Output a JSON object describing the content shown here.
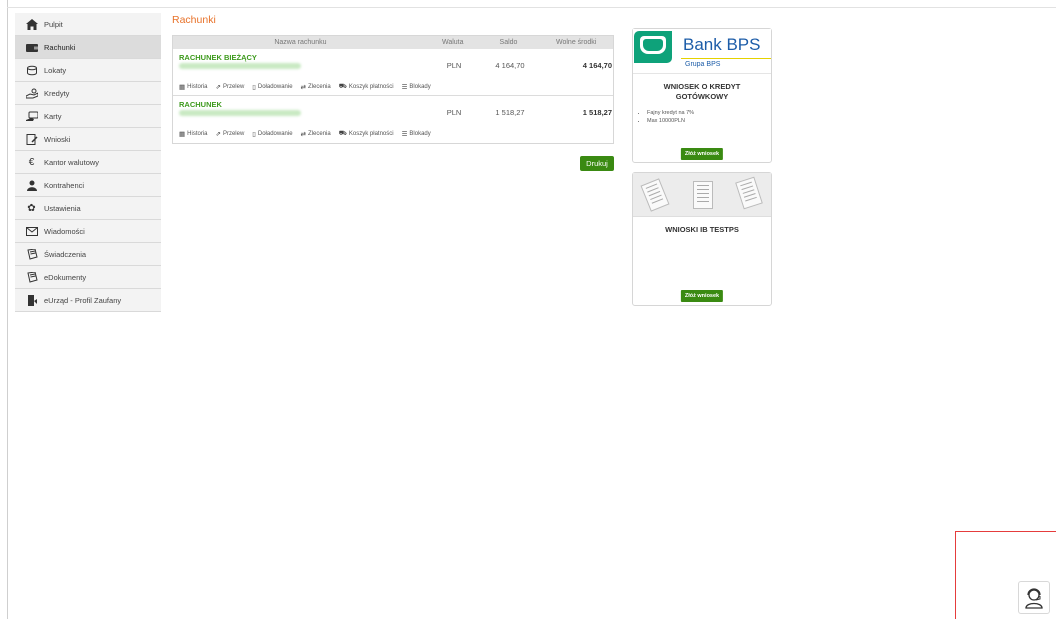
{
  "sidebar": {
    "items": [
      {
        "label": "Pulpit",
        "icon": "home-icon",
        "active": false
      },
      {
        "label": "Rachunki",
        "icon": "wallet-icon",
        "active": true
      },
      {
        "label": "Lokaty",
        "icon": "coins-icon",
        "active": false
      },
      {
        "label": "Kredyty",
        "icon": "hand-money-icon",
        "active": false
      },
      {
        "label": "Karty",
        "icon": "card-hand-icon",
        "active": false
      },
      {
        "label": "Wnioski",
        "icon": "form-icon",
        "active": false
      },
      {
        "label": "Kantor walutowy",
        "icon": "euro-icon",
        "active": false
      },
      {
        "label": "Kontrahenci",
        "icon": "users-icon",
        "active": false
      },
      {
        "label": "Ustawienia",
        "icon": "gear-icon",
        "active": false
      },
      {
        "label": "Wiadomości",
        "icon": "envelope-icon",
        "active": false
      },
      {
        "label": "Świadczenia",
        "icon": "document-icon",
        "active": false
      },
      {
        "label": "eDokumenty",
        "icon": "document-icon",
        "active": false
      },
      {
        "label": "eUrząd - Profil Zaufany",
        "icon": "profile-icon",
        "active": false
      }
    ]
  },
  "main": {
    "title": "Rachunki",
    "table": {
      "headers": {
        "name": "Nazwa rachunku",
        "currency": "Waluta",
        "balance": "Saldo",
        "free": "Wolne środki"
      },
      "rows": [
        {
          "name": "RACHUNEK BIEŻĄCY",
          "currency": "PLN",
          "balance": "4 164,70",
          "free": "4 164,70"
        },
        {
          "name": "RACHUNEK",
          "currency": "PLN",
          "balance": "1 518,27",
          "free": "1 518,27"
        }
      ],
      "actions": {
        "history": "Historia",
        "transfer": "Przelew",
        "topup": "Doładowanie",
        "orders": "Zlecenia",
        "cart": "Koszyk płatności",
        "blocks": "Blokady"
      }
    },
    "print_label": "Drukuj"
  },
  "promo": {
    "bank_name": "Bank BPS",
    "bank_group": "Grupa BPS",
    "card1": {
      "title": "WNIOSEK O KREDYT GOTÓWKOWY",
      "bullets": [
        "Fajny kredyt na 7%",
        "Max 10000PLN"
      ],
      "button": "Złóż wniosek"
    },
    "card2": {
      "title": "WNIOSKI IB TESTPS",
      "button": "Złóż wniosek"
    }
  },
  "colors": {
    "accent": "#e8722a",
    "green": "#3a8a12",
    "link_green": "#3d9a1c"
  }
}
